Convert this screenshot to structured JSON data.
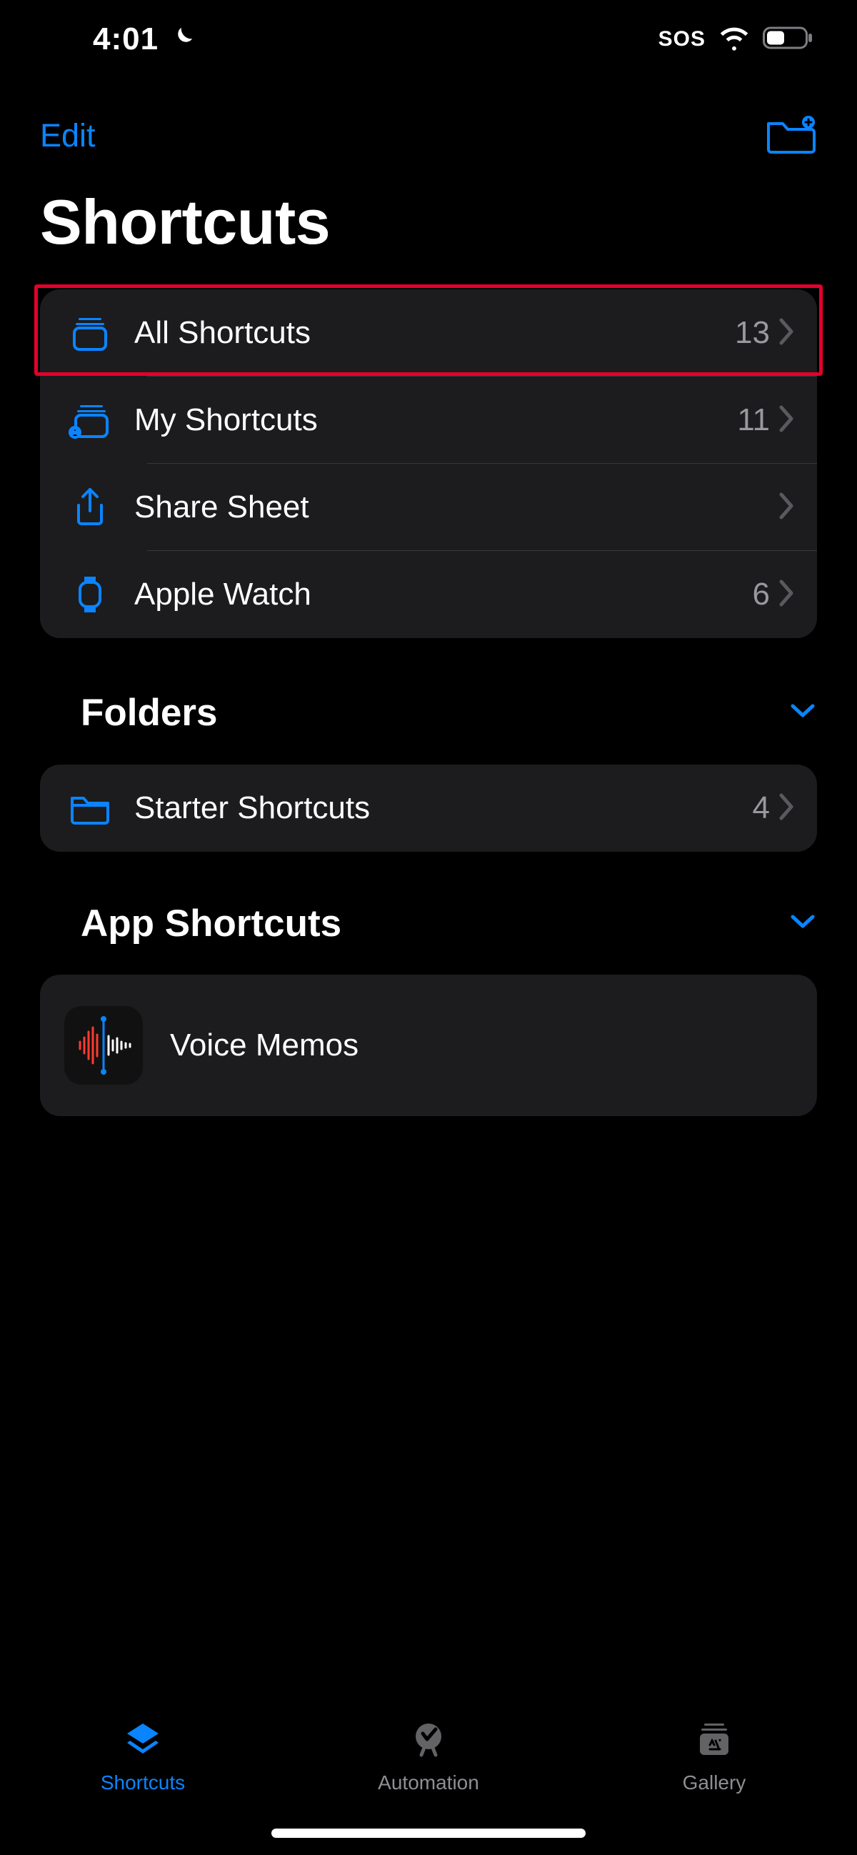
{
  "status": {
    "time": "4:01",
    "sos": "SOS"
  },
  "nav": {
    "edit": "Edit"
  },
  "title": "Shortcuts",
  "primary": {
    "all": {
      "label": "All Shortcuts",
      "count": "13"
    },
    "my": {
      "label": "My Shortcuts",
      "count": "11"
    },
    "share": {
      "label": "Share Sheet",
      "count": ""
    },
    "watch": {
      "label": "Apple Watch",
      "count": "6"
    }
  },
  "sections": {
    "folders_title": "Folders",
    "apps_title": "App Shortcuts"
  },
  "folders": {
    "starter": {
      "label": "Starter Shortcuts",
      "count": "4"
    }
  },
  "apps": {
    "voice_memos": {
      "label": "Voice Memos"
    }
  },
  "tabs": {
    "shortcuts": "Shortcuts",
    "automation": "Automation",
    "gallery": "Gallery"
  }
}
